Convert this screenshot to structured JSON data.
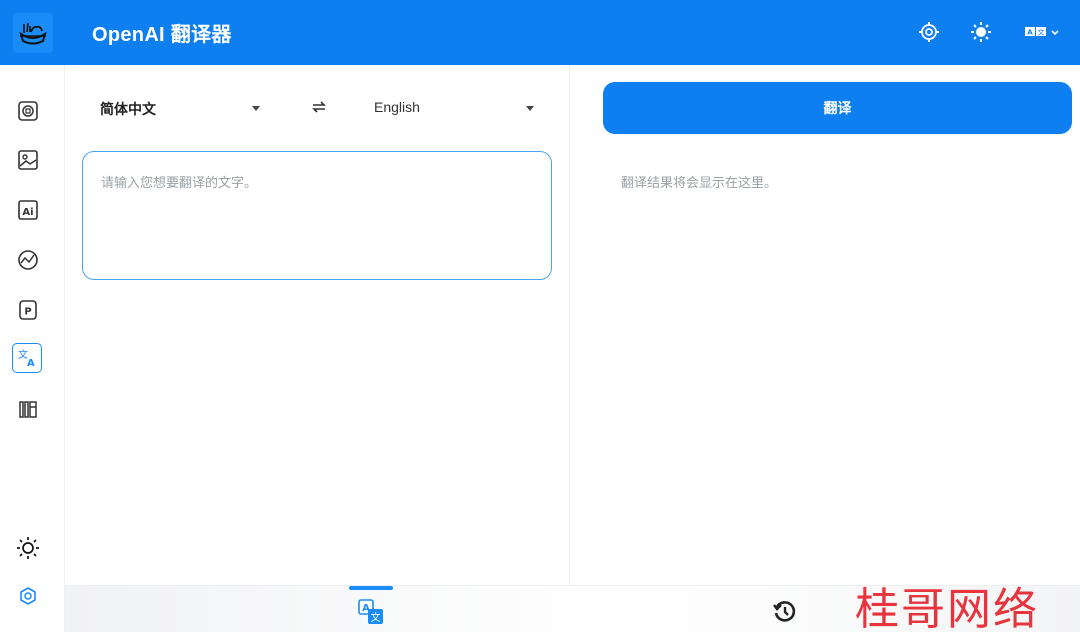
{
  "app": {
    "title": "OpenAI 翻译器"
  },
  "colors": {
    "primary": "#0d7ff0",
    "accent": "#1a8cf7",
    "watermark": "#e8343d"
  },
  "sidebar": {
    "items": [
      {
        "name": "gpt-chat",
        "icon": "chat-icon"
      },
      {
        "name": "image",
        "icon": "image-icon"
      },
      {
        "name": "ai",
        "icon": "ai-icon"
      },
      {
        "name": "chart",
        "icon": "chart-icon"
      },
      {
        "name": "p-doc",
        "icon": "p-icon"
      },
      {
        "name": "translate",
        "icon": "translate-icon",
        "active": true
      },
      {
        "name": "library",
        "icon": "library-icon"
      }
    ],
    "bottom": [
      {
        "icon": "sun-outline-icon"
      },
      {
        "icon": "hexagon-icon"
      }
    ]
  },
  "header": {
    "icons": [
      "settings-icon",
      "theme-icon",
      "language-switch-icon"
    ]
  },
  "translator": {
    "source_lang": "简体中文",
    "target_lang": "English",
    "input_placeholder": "请输入您想要翻译的文字。",
    "input_value": "",
    "translate_button": "翻译",
    "result_placeholder": "翻译结果将会显示在这里。"
  },
  "bottom_nav": {
    "tabs": [
      {
        "icon": "translate-icon",
        "active": true
      },
      {
        "icon": "history-icon"
      }
    ],
    "watermark": "桂哥网络"
  }
}
